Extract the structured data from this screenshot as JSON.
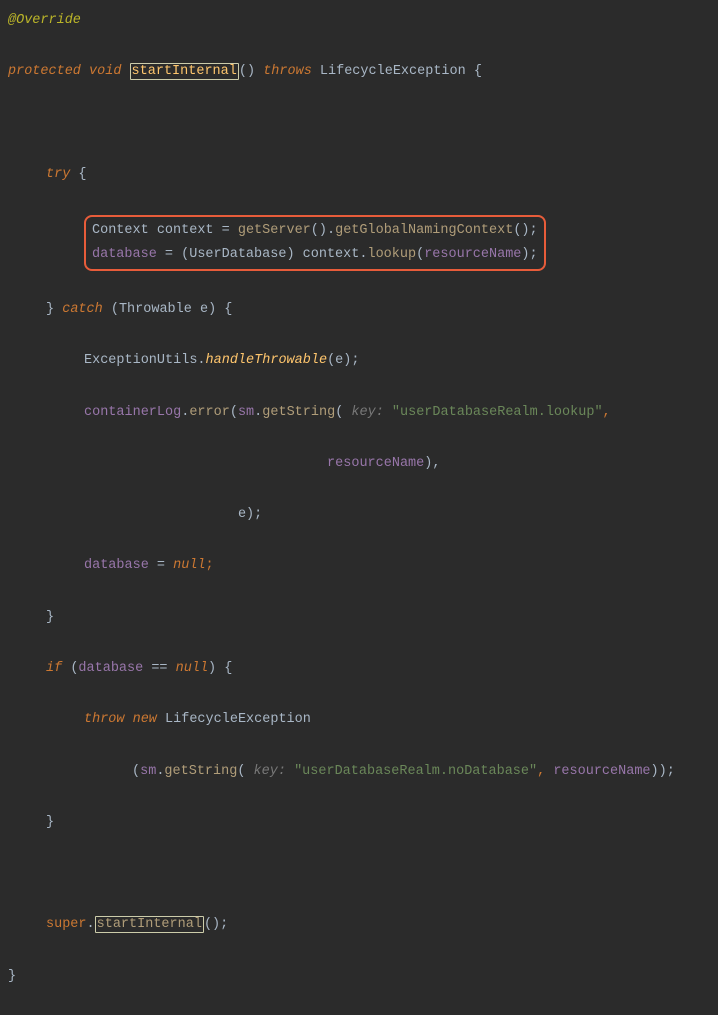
{
  "l1": {
    "annot": "@Override"
  },
  "l2": {
    "protected": "protected",
    "void": "void",
    "fn": "startInternal",
    "parens": "()",
    "throws": "throws",
    "exc": "LifecycleException",
    "brace": "{"
  },
  "l4": {
    "try": "try",
    "brace": "{"
  },
  "hl1": {
    "ctxType": "Context",
    "ctxVar": "context",
    "eq": " = ",
    "getServer": "getServer",
    "p1": "().",
    "gnc": "getGlobalNamingContext",
    "p2": "();"
  },
  "hl2": {
    "database": "database",
    "eq": " = (",
    "cast": "UserDatabase",
    "p1": ") ",
    "ctx": "context",
    "dot": ".",
    "lookup": "lookup",
    "p2": "(",
    "rn": "resourceName",
    "p3": ");"
  },
  "l7": {
    "close": "}",
    "catch": "catch",
    "p1": "(",
    "thr": "Throwable",
    "e": "e",
    "p2": ") {"
  },
  "l8": {
    "cls": "ExceptionUtils",
    "dot": ".",
    "fn": "handleThrowable",
    "p1": "(",
    "e": "e",
    "p2": ");"
  },
  "l9": {
    "cl": "containerLog",
    "dot1": ".",
    "err": "error",
    "p1": "(",
    "sm": "sm",
    "dot2": ".",
    "gs": "getString",
    "p2": "(",
    "param": " key: ",
    "str": "\"userDatabaseRealm.lookup\"",
    "p3": ","
  },
  "l10": {
    "pad": "                              ",
    "rn": "resourceName",
    "p": "),"
  },
  "l11": {
    "pad": "                   ",
    "e": "e",
    "p": ");"
  },
  "l12": {
    "database": "database",
    "eq": " = ",
    "null": "null",
    "p": ";"
  },
  "l13": {
    "close": "}"
  },
  "l14": {
    "if": "if",
    "p1": "(",
    "database": "database",
    "eq": " == ",
    "null": "null",
    "p2": ") {"
  },
  "l15": {
    "throw": "throw new",
    "exc": "LifecycleException"
  },
  "l16": {
    "p1": "(",
    "sm": "sm",
    "dot": ".",
    "gs": "getString",
    "p2": "(",
    "param": " key: ",
    "str": "\"userDatabaseRealm.noDatabase\"",
    "c": ", ",
    "rn": "resourceName",
    "p3": "));"
  },
  "l17": {
    "close": "}"
  },
  "l19": {
    "super": "super",
    "dot": ".",
    "fn": "startInternal",
    "p": "();"
  },
  "l20": {
    "close": "}"
  }
}
